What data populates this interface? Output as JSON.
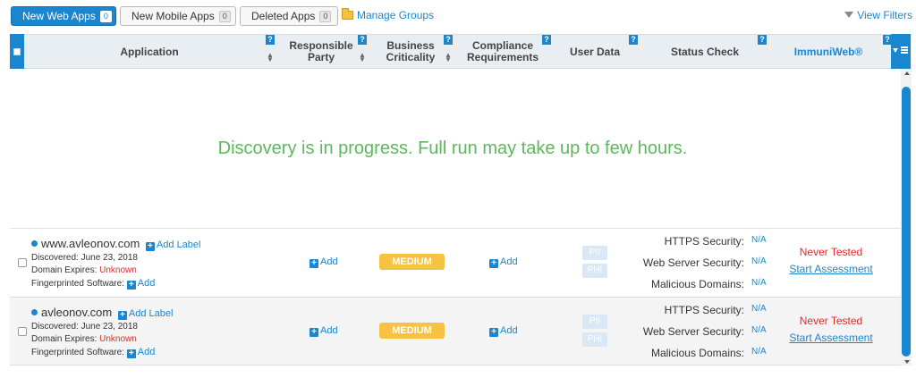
{
  "tabs": [
    {
      "label": "New Web Apps",
      "count": "0"
    },
    {
      "label": "New Mobile Apps",
      "count": "0"
    },
    {
      "label": "Deleted Apps",
      "count": "0"
    }
  ],
  "manage_groups": "Manage Groups",
  "view_filters": "View Filters",
  "help_mark": "?",
  "columns": {
    "application": "Application",
    "responsible_party": "Responsible Party",
    "business_criticality": "Business Criticality",
    "compliance_requirements": "Compliance Requirements",
    "user_data": "User Data",
    "status_check": "Status Check",
    "immuniweb": "ImmuniWeb®"
  },
  "discovery_message": "Discovery is in progress. Full run may take up to few hours.",
  "rows": [
    {
      "domain": "www.avleonov.com",
      "add_label": "Add Label",
      "discovered": "Discovered: June 23, 2018",
      "expires_label": "Domain Expires:",
      "expires_value": "Unknown",
      "software_label": "Fingerprinted Software:",
      "software_add": "Add",
      "responsible_add": "Add",
      "criticality": "MEDIUM",
      "compliance_add": "Add",
      "pii": "PII",
      "phi": "PHI",
      "https_label": "HTTPS Security:",
      "https_value": "N/A",
      "webserver_label": "Web Server Security:",
      "webserver_value": "N/A",
      "malicious_label": "Malicious Domains:",
      "malicious_value": "N/A",
      "never_tested": "Never Tested",
      "start_assessment": "Start Assessment"
    },
    {
      "domain": "avleonov.com",
      "add_label": "Add Label",
      "discovered": "Discovered: June 23, 2018",
      "expires_label": "Domain Expires:",
      "expires_value": "Unknown",
      "software_label": "Fingerprinted Software:",
      "software_add": "Add",
      "responsible_add": "Add",
      "criticality": "MEDIUM",
      "compliance_add": "Add",
      "pii": "PII",
      "phi": "PHI",
      "https_label": "HTTPS Security:",
      "https_value": "N/A",
      "webserver_label": "Web Server Security:",
      "webserver_value": "N/A",
      "malicious_label": "Malicious Domains:",
      "malicious_value": "N/A",
      "never_tested": "Never Tested",
      "start_assessment": "Start Assessment"
    }
  ],
  "colors": {
    "accent": "#1a86d0",
    "success": "#5cb85c",
    "warning": "#f5c242",
    "danger": "#e02b2b"
  }
}
